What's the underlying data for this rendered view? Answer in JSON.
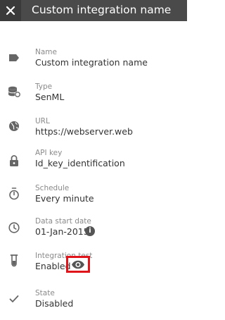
{
  "header": {
    "title": "Custom integration name",
    "close_icon": "close-icon"
  },
  "fields": {
    "name": {
      "label": "Name",
      "value": "Custom integration name",
      "icon": "label-tag-icon"
    },
    "type": {
      "label": "Type",
      "value": "SenML",
      "icon": "database-sync-icon"
    },
    "url": {
      "label": "URL",
      "value": "https://webserver.web",
      "icon": "globe-icon"
    },
    "api_key": {
      "label": "API key",
      "value": "Id_key_identification",
      "icon": "lock-icon"
    },
    "schedule": {
      "label": "Schedule",
      "value": "Every minute",
      "icon": "timer-icon"
    },
    "data_start": {
      "label": "Data start date",
      "value": "01-Jan-2015",
      "icon": "clock-icon",
      "info_glyph": "i"
    },
    "integration_test": {
      "label": "Integration test",
      "value": "Enabled",
      "icon": "test-tube-icon",
      "action_icon": "eye-icon"
    },
    "state": {
      "label": "State",
      "value": "Disabled",
      "icon": "check-icon"
    }
  },
  "colors": {
    "header_bg": "#4a4a4a",
    "close_bg": "#3a3a3a",
    "icon": "#666666",
    "highlight": "#e0151b"
  }
}
